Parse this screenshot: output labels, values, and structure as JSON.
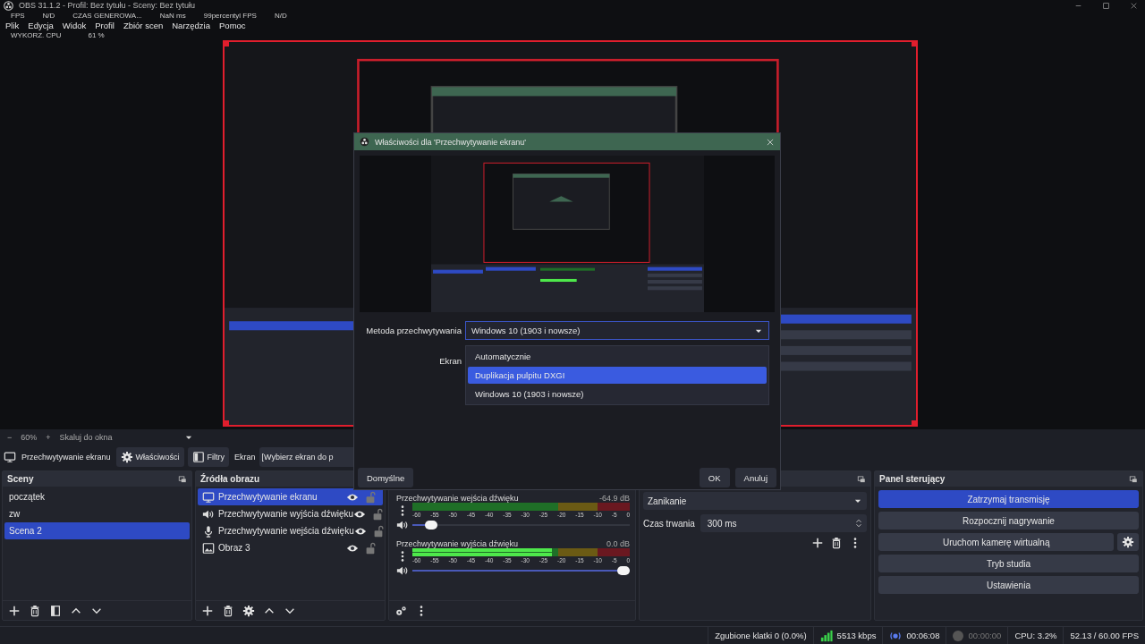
{
  "window": {
    "title": "OBS 31.1.2 - Profil: Bez tytułu - Sceny: Bez tytułu"
  },
  "stats": [
    {
      "label": "FPS",
      "value": "N/D"
    },
    {
      "label": "CZAS GENEROWA...",
      "value": "NaN ms"
    },
    {
      "label": "99percentyl FPS",
      "value": "N/D"
    }
  ],
  "cpu_stat": {
    "label": "WYKORZ. CPU",
    "value": "61 %"
  },
  "menu": [
    "Plik",
    "Edycja",
    "Widok",
    "Profil",
    "Zbiór scen",
    "Narzędzia",
    "Pomoc"
  ],
  "zoom_bar": {
    "zoom_out": "−",
    "zoom": "60%",
    "zoom_in": "+",
    "scale_mode": "Skaluj do okna"
  },
  "source_toolbar": {
    "source": "Przechwytywanie ekranu",
    "properties": "Właściwości",
    "filters": "Filtry",
    "screen_label": "Ekran",
    "screen_value": "[Wybierz ekran do p"
  },
  "scenes": {
    "title": "Sceny",
    "items": [
      {
        "name": "początek",
        "selected": false
      },
      {
        "name": "zw",
        "selected": false
      },
      {
        "name": "Scena 2",
        "selected": true
      }
    ]
  },
  "sources": {
    "title": "Źródła obrazu",
    "items": [
      {
        "name": "Przechwytywanie ekranu",
        "kind": "screen",
        "selected": true,
        "visible": true,
        "locked": false
      },
      {
        "name": "Przechwytywanie wyjścia dźwięku",
        "kind": "speaker",
        "selected": false,
        "visible": true,
        "locked": false
      },
      {
        "name": "Przechwytywanie wejścia dźwięku",
        "kind": "mic",
        "selected": false,
        "visible": true,
        "locked": false
      },
      {
        "name": "Obraz 3",
        "kind": "image",
        "selected": false,
        "visible": true,
        "locked": false
      }
    ]
  },
  "mixer": {
    "channels": [
      {
        "name": "Przechwytywanie wejścia dźwięku",
        "reading": "-64.9 dB",
        "meter": {
          "level": 0
        },
        "volume": {
          "level": 0.06
        },
        "scale": [
          "-60",
          "-55",
          "-50",
          "-45",
          "-40",
          "-35",
          "-30",
          "-25",
          "-20",
          "-15",
          "-10",
          "-5",
          "0"
        ]
      },
      {
        "name": "Przechwytywanie wyjścia dźwięku",
        "reading": "0.0 dB",
        "meter": {
          "level": 0.64
        },
        "volume": {
          "level": 1
        },
        "scale": [
          "-60",
          "-55",
          "-50",
          "-45",
          "-40",
          "-35",
          "-30",
          "-25",
          "-20",
          "-15",
          "-10",
          "-5",
          "0"
        ]
      }
    ]
  },
  "transitions": {
    "type": "Zanikanie",
    "duration_label": "Czas trwania",
    "duration": "300 ms"
  },
  "controls": {
    "title": "Panel sterujący",
    "buttons": [
      {
        "label": "Zatrzymaj transmisję",
        "active": true,
        "kind": "plain"
      },
      {
        "label": "Rozpocznij nagrywanie",
        "active": false,
        "kind": "plain"
      },
      {
        "label": "Uruchom kamerę wirtualną",
        "active": false,
        "kind": "settings"
      },
      {
        "label": "Tryb studia",
        "active": false,
        "kind": "plain"
      },
      {
        "label": "Ustawienia",
        "active": false,
        "kind": "plain"
      }
    ]
  },
  "dialog": {
    "title": "Właściwości dla 'Przechwytywanie ekranu'",
    "method_label": "Metoda przechwytywania",
    "method_value": "Windows 10 (1903 i nowsze)",
    "screen_label": "Ekran",
    "options": [
      {
        "label": "Automatycznie",
        "selected": false
      },
      {
        "label": "Duplikacja pulpitu DXGI",
        "selected": true
      },
      {
        "label": "Windows 10 (1903 i nowsze)",
        "selected": false
      }
    ],
    "defaults": "Domyślne",
    "ok": "OK",
    "cancel": "Anuluj"
  },
  "status_bar": {
    "dropped": "Zgubione klatki 0 (0.0%)",
    "bitrate": "5513 kbps",
    "stream_time": "00:06:08",
    "recording": false,
    "record_time": "00:00:00",
    "cpu": "CPU: 3.2%",
    "fps": "52.13 / 60.00 FPS"
  }
}
